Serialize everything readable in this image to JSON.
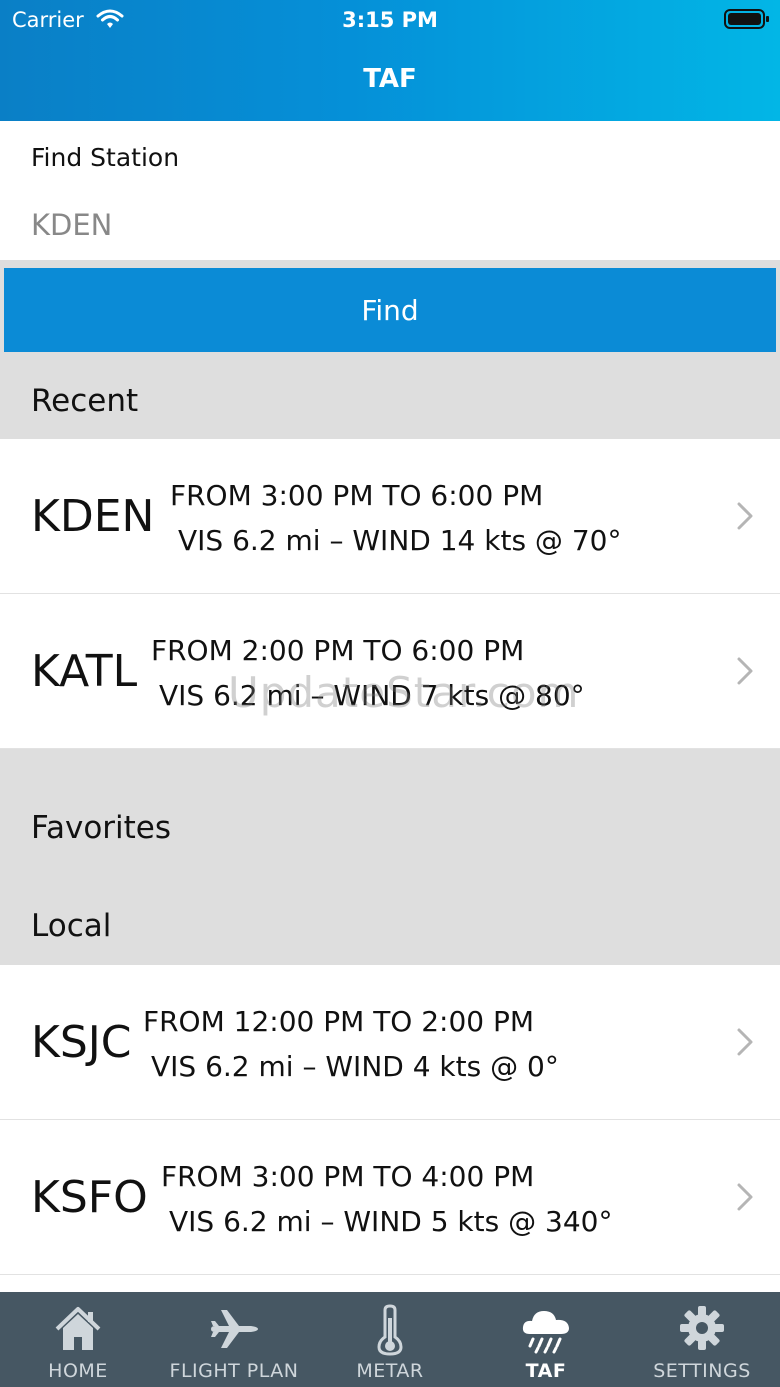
{
  "status_bar": {
    "carrier": "Carrier",
    "time": "3:15 PM"
  },
  "header": {
    "title": "TAF"
  },
  "search": {
    "label": "Find Station",
    "value": "KDEN",
    "button_label": "Find"
  },
  "sections": {
    "recent": "Recent",
    "favorites": "Favorites",
    "local": "Local"
  },
  "recent": [
    {
      "code": "KDEN",
      "line1": "FROM 3:00 PM TO 6:00 PM",
      "line2": "VIS 6.2 mi – WIND 14 kts @ 70°"
    },
    {
      "code": "KATL",
      "line1": "FROM 2:00 PM TO 6:00 PM",
      "line2": "VIS 6.2 mi – WIND 7 kts @ 80°"
    }
  ],
  "local": [
    {
      "code": "KSJC",
      "line1": "FROM 12:00 PM TO 2:00 PM",
      "line2": "VIS 6.2 mi – WIND 4 kts @ 0°"
    },
    {
      "code": "KSFO",
      "line1": "FROM 3:00 PM TO 4:00 PM",
      "line2": "VIS 6.2 mi – WIND 5 kts @ 340°"
    }
  ],
  "watermark": "UpdateStar.com",
  "tabs": [
    {
      "label": "HOME",
      "icon": "home-icon"
    },
    {
      "label": "FLIGHT PLAN",
      "icon": "airplane-icon"
    },
    {
      "label": "METAR",
      "icon": "thermometer-icon"
    },
    {
      "label": "TAF",
      "icon": "rain-cloud-icon",
      "active": true
    },
    {
      "label": "SETTINGS",
      "icon": "gear-icon"
    }
  ],
  "colors": {
    "header_start": "#0a7fc6",
    "header_end": "#02b6e6",
    "button": "#0b8bd6",
    "tabbar": "#465763",
    "section": "#dedede"
  }
}
